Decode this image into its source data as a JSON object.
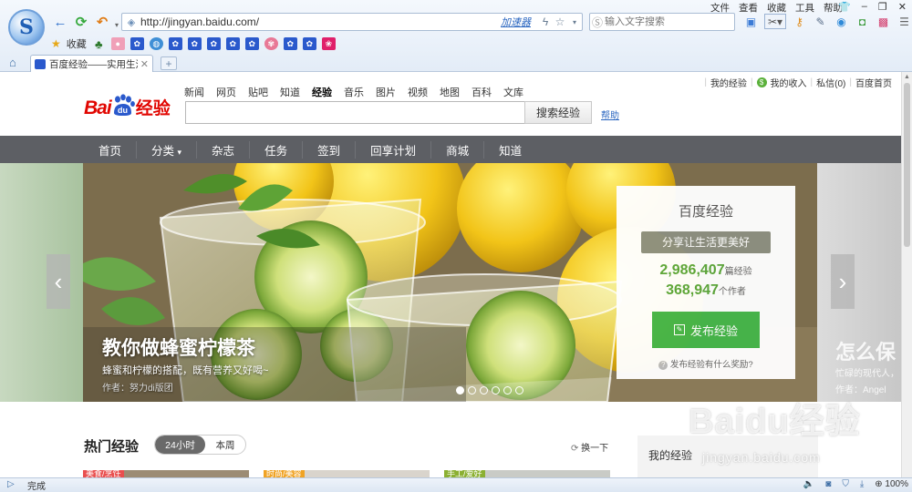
{
  "browser": {
    "logo_letter": "S",
    "url": "http://jingyan.baidu.com/",
    "accelerator": "加速器",
    "search_placeholder": "输入文字搜索",
    "menus": [
      "文件",
      "查看",
      "收藏",
      "工具",
      "帮助"
    ],
    "favorites_label": "收藏",
    "tab_title": "百度经验——实用生活指",
    "status_text": "完成",
    "zoom": "100%"
  },
  "page": {
    "top_links": [
      "我的经验",
      "我的收入",
      "私信(0)",
      "百度首页"
    ],
    "brand_bai": "Bai",
    "brand_du": "du",
    "brand_jingyan": "经验",
    "channels": [
      "新闻",
      "网页",
      "贴吧",
      "知道",
      "经验",
      "音乐",
      "图片",
      "视频",
      "地图",
      "百科",
      "文库"
    ],
    "active_channel": "经验",
    "search_button": "搜索经验",
    "help_link": "帮助",
    "nav": [
      "首页",
      "分类",
      "杂志",
      "任务",
      "签到",
      "回享计划",
      "商城",
      "知道"
    ],
    "nav_dropdown_arrow": "▾"
  },
  "hero": {
    "title": "教你做蜂蜜柠檬茶",
    "subtitle": "蜂蜜和柠檬的搭配，既有营养又好喝~",
    "author": "作者：努力di版团",
    "next_title": "怎么保",
    "next_sub": "忙碌的现代人，",
    "next_author": "作者：Angel",
    "slide_count": 6,
    "active_slide": 0
  },
  "card": {
    "title": "百度经验",
    "slogan": "分享让生活更美好",
    "experiences": "2,986,407",
    "experiences_unit": "篇经验",
    "authors": "368,947",
    "authors_unit": "个作者",
    "publish_button": "发布经验",
    "reward_text": "发布经验有什么奖励?"
  },
  "hot": {
    "title": "热门经验",
    "toggle": [
      "24小时",
      "本周"
    ],
    "refresh": "换一下",
    "my_experience": "我的经验",
    "tags": [
      "美食/烹饪",
      "时尚/美容",
      "手工/爱好"
    ]
  },
  "watermark": {
    "main": "Baidu经验",
    "sub": "jingyan.baidu.com"
  },
  "colors": {
    "baidu_red": "#e10601",
    "nav_bg": "#5d5f64",
    "accent_green": "#44b549",
    "link_blue": "#2a66c0"
  }
}
